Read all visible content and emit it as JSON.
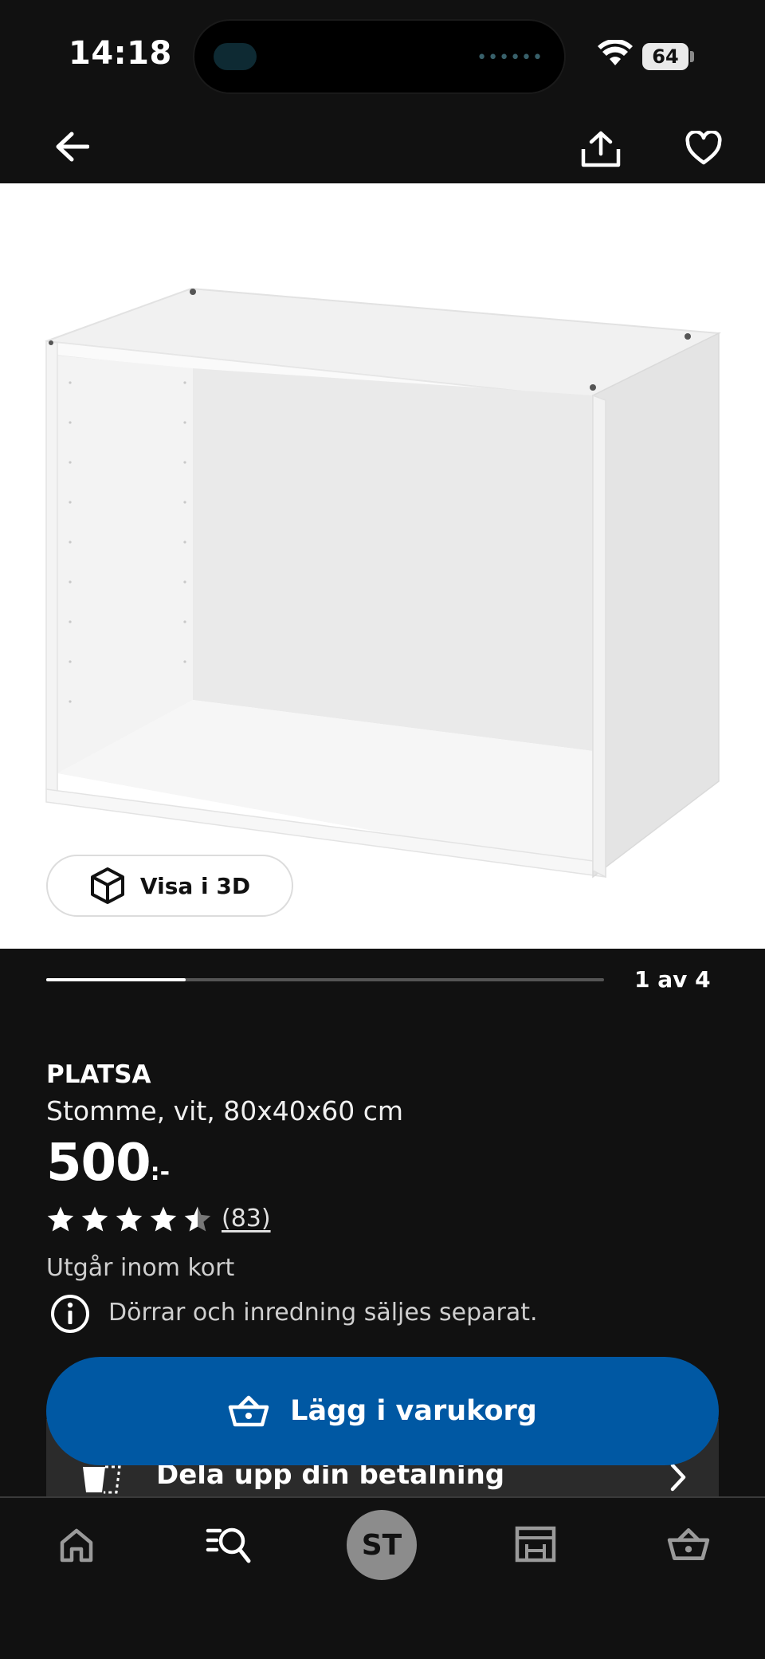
{
  "status_bar": {
    "time": "14:18",
    "battery": "64"
  },
  "top_nav": {
    "back_icon": "arrow-left-icon",
    "share_icon": "share-icon",
    "favorite_icon": "heart-icon"
  },
  "gallery": {
    "view_3d_label": "Visa i 3D",
    "pager": "1 av 4",
    "progress": 0.25
  },
  "product": {
    "brand": "PLATSA",
    "description": "Stomme, vit, 80x40x60 cm",
    "price": "500",
    "price_suffix": ":-",
    "rating": 4.5,
    "review_count": "(83)",
    "availability": "Utgår inom kort",
    "info_note": "Dörrar och inredning säljes separat."
  },
  "cta": {
    "label": "Lägg i varukorg"
  },
  "installment": {
    "label": "Dela upp din betalning"
  },
  "bottom_nav": {
    "avatar_initials": "ST"
  },
  "colors": {
    "background": "#111111",
    "cta": "#0058a3",
    "card": "#2b2b2b"
  }
}
